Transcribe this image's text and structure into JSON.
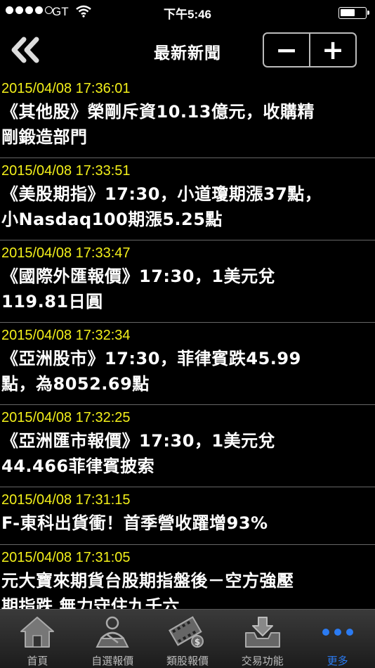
{
  "status_bar": {
    "carrier": "GT",
    "time": "下午5:46"
  },
  "nav": {
    "title": "最新新聞",
    "zoom_out_label": "−",
    "zoom_in_label": "+"
  },
  "news": [
    {
      "time": "2015/04/08 17:36:01",
      "headline": "《其他股》榮剛斥資10.13億元，收購精\n剛鍛造部門"
    },
    {
      "time": "2015/04/08 17:33:51",
      "headline": "《美股期指》17:30，小道瓊期漲37點，\n小Nasdaq100期漲5.25點"
    },
    {
      "time": "2015/04/08 17:33:47",
      "headline": "《國際外匯報價》17:30，1美元兌\n119.81日圓"
    },
    {
      "time": "2015/04/08 17:32:34",
      "headline": "《亞洲股市》17:30，菲律賓跌45.99\n點，為8052.69點"
    },
    {
      "time": "2015/04/08 17:32:25",
      "headline": "《亞洲匯市報價》17:30，1美元兌\n44.466菲律賓披索"
    },
    {
      "time": "2015/04/08 17:31:15",
      "headline": "F-東科出貨衝！首季營收躍增93%"
    },
    {
      "time": "2015/04/08 17:31:05",
      "headline": "元大寶來期貨台股期指盤後－空方強壓\n期指跌 無力守住九千六"
    }
  ],
  "tabs": [
    {
      "label": "首頁",
      "icon": "home-icon"
    },
    {
      "label": "自選報價",
      "icon": "person-quote-icon"
    },
    {
      "label": "類股報價",
      "icon": "film-quote-icon"
    },
    {
      "label": "交易功能",
      "icon": "download-tray-icon"
    },
    {
      "label": "更多",
      "icon": "more-dots-icon"
    }
  ],
  "colors": {
    "timestamp": "#f3f01a",
    "active_tab": "#2b7bf2"
  }
}
